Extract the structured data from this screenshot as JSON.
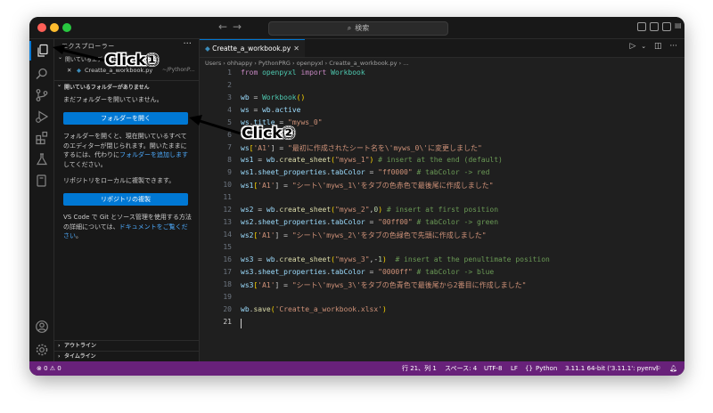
{
  "titlebar": {
    "search_text": "検索"
  },
  "sidebar": {
    "title": "エクスプローラー",
    "more": "···",
    "open_editors": "開いているエディター",
    "open_file_name": "Creatte_a_workbook.py",
    "open_file_path": "~/PythonP...",
    "no_folder_header": "開いているフォルダーがありません",
    "no_folder_msg": "まだフォルダーを開いていません。",
    "open_folder_button": "フォルダーを開く",
    "info_text_1": "フォルダーを開くと、現在開いているすべてのエディターが閉じられます。開いたままにするには、代わりに",
    "info_link_1": "フォルダーを追加します",
    "info_text_1b": "してください。",
    "clone_msg": "リポジトリをローカルに複製できます。",
    "clone_button": "リポジトリの複製",
    "info_text_2": "VS Code で Git とソース管理を使用する方法の詳細については、",
    "info_link_2": "ドキュメントをご覧ください",
    "info_text_2b": "。",
    "outline": "アウトライン",
    "timeline": "タイムライン"
  },
  "tabs": [
    {
      "label": "Creatte_a_workbook.py"
    }
  ],
  "breadcrumb": {
    "text": "Users › ohhappy › PythonPRG › openpyxl › Creatte_a_workbook.py › ..."
  },
  "editor": {
    "line_numbers": [
      "1",
      "2",
      "3",
      "4",
      "5",
      "6",
      "7",
      "8",
      "9",
      "10",
      "11",
      "12",
      "13",
      "14",
      "15",
      "16",
      "17",
      "18",
      "19",
      "20",
      "21"
    ],
    "l1": {
      "a": "from ",
      "b": "openpyxl",
      "c": " import ",
      "d": "Workbook"
    },
    "l3": {
      "a": "wb",
      "b": " = ",
      "c": "Workbook",
      "d": "()"
    },
    "l4": {
      "a": "ws",
      "b": " = ",
      "c": "wb",
      "d": ".",
      "e": "active"
    },
    "l5": {
      "a": "ws",
      "b": ".",
      "c": "title",
      "d": " = ",
      "e": "\"myws_0\""
    },
    "l7": {
      "a": "ws",
      "b": "[",
      "c": "'A1'",
      "d": "] = ",
      "e": "\"最初に作成されたシート名を\\'myws_0\\'に変更しました\""
    },
    "l8": {
      "a": "ws1",
      "b": " = ",
      "c": "wb",
      "d": ".",
      "e": "create_sheet",
      "f": "(",
      "g": "\"myws_1\"",
      "h": ") ",
      "i": "# insert at the end (default)"
    },
    "l9": {
      "a": "ws1",
      "b": ".",
      "c": "sheet_properties",
      "d": ".",
      "e": "tabColor",
      "f": " = ",
      "g": "\"ff0000\"",
      "h": " ",
      "i": "# tabColor -> red"
    },
    "l10": {
      "a": "ws1",
      "b": "[",
      "c": "'A1'",
      "d": "] = ",
      "e": "\"シート\\'myws_1\\'をタブの色赤色で最後尾に作成しました\""
    },
    "l12": {
      "a": "ws2",
      "b": " = ",
      "c": "wb",
      "d": ".",
      "e": "create_sheet",
      "f": "(",
      "g": "\"myws_2\"",
      "h": ",",
      "i": "0",
      "j": ") ",
      "k": "# insert at first position"
    },
    "l13": {
      "a": "ws2",
      "b": ".",
      "c": "sheet_properties",
      "d": ".",
      "e": "tabColor",
      "f": " = ",
      "g": "\"00ff00\"",
      "h": " ",
      "i": "# tabColor -> green"
    },
    "l14": {
      "a": "ws2",
      "b": "[",
      "c": "'A1'",
      "d": "] = ",
      "e": "\"シート\\'myws_2\\'をタブの色緑色で先頭に作成しました\""
    },
    "l16": {
      "a": "ws3",
      "b": " = ",
      "c": "wb",
      "d": ".",
      "e": "create_sheet",
      "f": "(",
      "g": "\"myws_3\"",
      "h": ",-",
      "i": "1",
      "j": ")  ",
      "k": "# insert at the penultimate position"
    },
    "l17": {
      "a": "ws3",
      "b": ".",
      "c": "sheet_properties",
      "d": ".",
      "e": "tabColor",
      "f": " = ",
      "g": "\"0000ff\"",
      "h": " ",
      "i": "# tabColor -> blue"
    },
    "l18": {
      "a": "ws3",
      "b": "[",
      "c": "'A1'",
      "d": "] = ",
      "e": "\"シート\\'myws_3\\'をタブの色青色で最後尾から2番目に作成しました\""
    },
    "l20": {
      "a": "wb",
      "b": ".",
      "c": "save",
      "d": "(",
      "e": "'Creatte_a_workbook.xlsx'",
      "f": ")"
    }
  },
  "statusbar": {
    "problems": "⊗ 0 ⚠ 0",
    "position": "行 21、列 1",
    "spaces": "スペース: 4",
    "encoding": "UTF-8",
    "eol": "LF",
    "language": "Python",
    "interpreter": "3.11.1 64-bit ('3.11.1': pyenv)"
  },
  "annotations": {
    "click1": "Click①",
    "click2": "Click②"
  },
  "colors": {
    "status_bar": "#68217a",
    "accent": "#0078d4",
    "annotation_arrow": "#000000"
  }
}
